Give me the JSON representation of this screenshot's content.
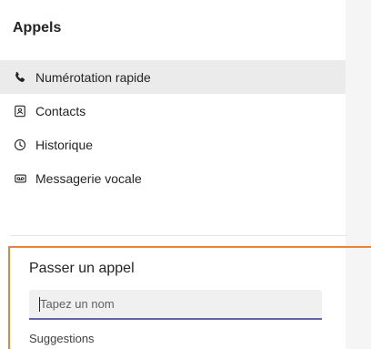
{
  "panel": {
    "title": "Appels"
  },
  "nav": {
    "items": [
      {
        "label": "Numérotation rapide",
        "icon": "phone-icon",
        "selected": true
      },
      {
        "label": "Contacts",
        "icon": "contacts-icon",
        "selected": false
      },
      {
        "label": "Historique",
        "icon": "clock-icon",
        "selected": false
      },
      {
        "label": "Messagerie vocale",
        "icon": "voicemail-icon",
        "selected": false
      }
    ]
  },
  "make_call": {
    "title": "Passer un appel",
    "input_value": "",
    "input_placeholder": "Tapez un nom",
    "suggestions_label": "Suggestions"
  },
  "colors": {
    "accent": "#6264a7",
    "highlight": "#e8833a",
    "selected_bg": "#ebebeb",
    "text": "#252423"
  }
}
